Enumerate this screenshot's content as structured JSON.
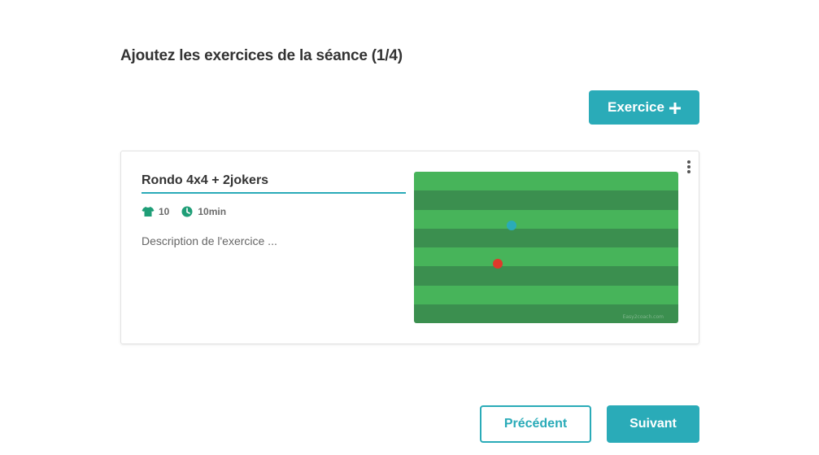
{
  "page": {
    "title": "Ajoutez les exercices de la séance (1/4)"
  },
  "toolbar": {
    "add_exercise_label": "Exercice",
    "add_exercise_icon": "plus-icon"
  },
  "exercise_card": {
    "title": "Rondo 4x4 + 2jokers",
    "players": "10",
    "players_icon": "shirt-icon",
    "duration": "10min",
    "duration_icon": "clock-icon",
    "description_placeholder": "Description de l'exercice ...",
    "menu_icon": "kebab-menu-icon",
    "pitch": {
      "stripe_colors": [
        "#47b45a",
        "#3b8f4f"
      ],
      "stripe_count": 8,
      "players": [
        {
          "color": "#2aabb8"
        },
        {
          "color": "#e0392b"
        }
      ],
      "watermark": "Easy2coach.com"
    }
  },
  "footer": {
    "previous_label": "Précédent",
    "next_label": "Suivant"
  },
  "colors": {
    "accent": "#2aabb8",
    "icon_green": "#1f9e77",
    "text_dark": "#333333"
  }
}
